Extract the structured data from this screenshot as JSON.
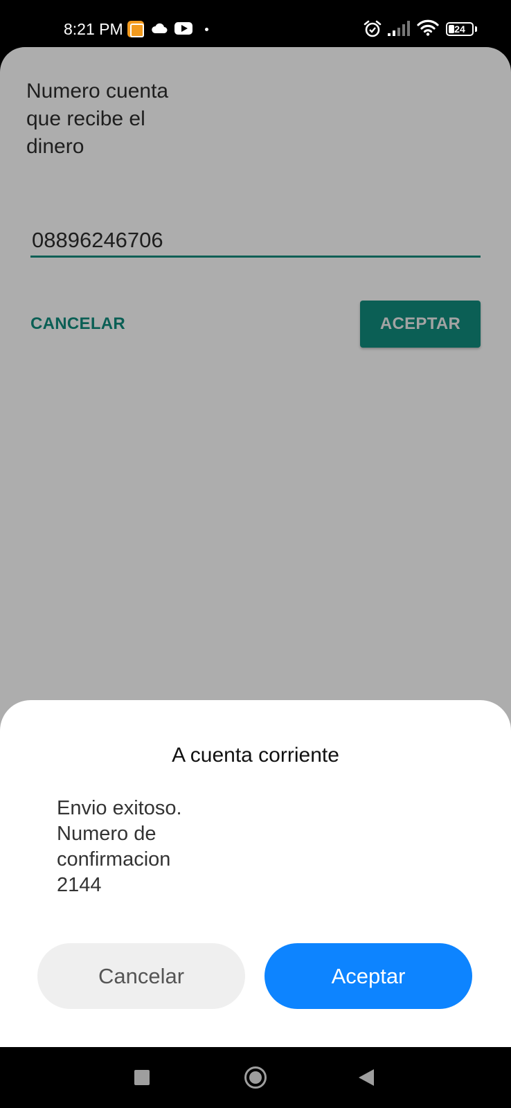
{
  "status_bar": {
    "time": "8:21 PM",
    "battery_level": "24",
    "battery_fraction": 0.24,
    "icons": [
      "app-notification-icon",
      "cloud-icon",
      "youtube-icon",
      "dot-icon",
      "alarm-icon",
      "signal-icon",
      "wifi-icon",
      "battery-icon"
    ]
  },
  "app": {
    "prompt_label": "Numero cuenta que recibe el dinero",
    "account_input": {
      "value": "08896246706"
    },
    "cancel_label": "CANCELAR",
    "accept_label": "ACEPTAR",
    "accent_color": "#0b5f55"
  },
  "dialog": {
    "title": "A cuenta corriente",
    "message": "Envio exitoso.\nNumero de confirmacion\n2144",
    "cancel_label": "Cancelar",
    "accept_label": "Aceptar",
    "accept_color": "#0d84ff"
  },
  "nav_bar": {
    "icons": [
      "recents-icon",
      "home-icon",
      "back-icon"
    ]
  }
}
